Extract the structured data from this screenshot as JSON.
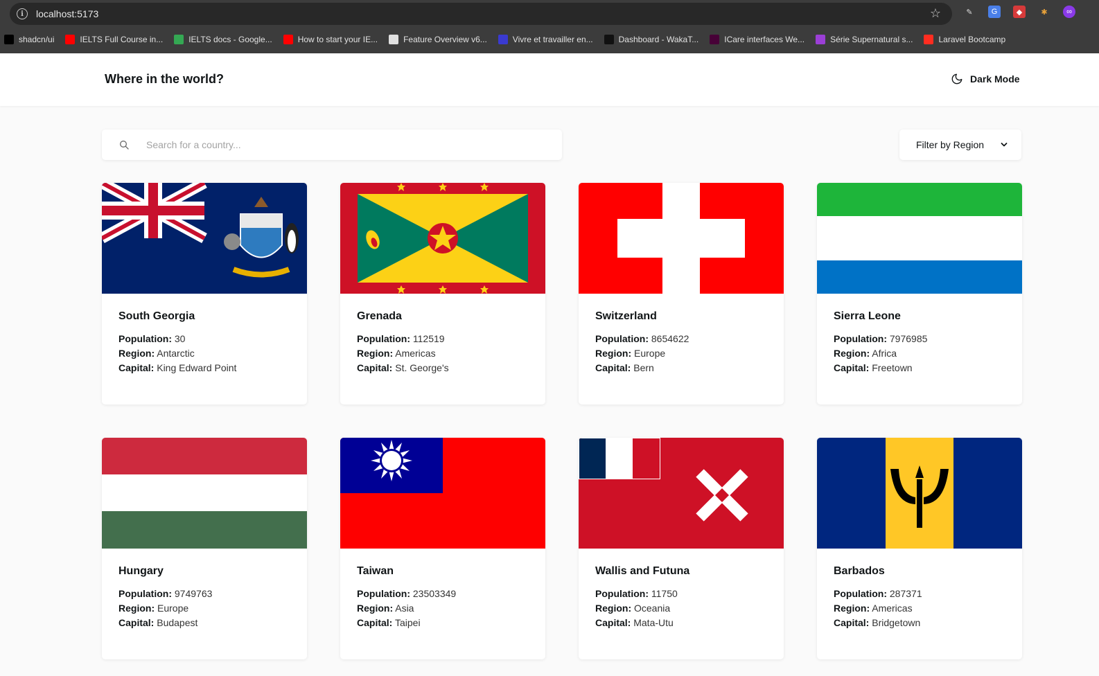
{
  "browser": {
    "url": "localhost:5173",
    "bookmarks": [
      {
        "label": "shadcn/ui",
        "icon": "shadcn-icon",
        "color": "#000000"
      },
      {
        "label": "IELTS Full Course in...",
        "icon": "youtube-icon",
        "color": "#ff0000"
      },
      {
        "label": "IELTS docs - Google...",
        "icon": "drive-icon",
        "color": "#34a853"
      },
      {
        "label": "How to start your IE...",
        "icon": "youtube-icon",
        "color": "#ff0000"
      },
      {
        "label": "Feature Overview v6...",
        "icon": "network-icon",
        "color": "#e0e0e0"
      },
      {
        "label": "Vivre et travailler en...",
        "icon": "quebec-icon",
        "color": "#3a3ad0"
      },
      {
        "label": "Dashboard - WakaT...",
        "icon": "wakatime-icon",
        "color": "#111111"
      },
      {
        "label": "ICare interfaces We...",
        "icon": "xd-icon",
        "color": "#470137"
      },
      {
        "label": "Série Supernatural s...",
        "icon": "flag-icon",
        "color": "#9b3fd6"
      },
      {
        "label": "Laravel Bootcamp",
        "icon": "laravel-icon",
        "color": "#ff2d20"
      }
    ]
  },
  "header": {
    "title": "Where in the world?",
    "dark_mode_label": "Dark Mode"
  },
  "search": {
    "placeholder": "Search for a country..."
  },
  "filter": {
    "label": "Filter by Region"
  },
  "labels": {
    "population": "Population:",
    "region": "Region:",
    "capital": "Capital:"
  },
  "countries": [
    {
      "name": "South Georgia",
      "population": "30",
      "region": "Antarctic",
      "capital": "King Edward Point",
      "flag": "south-georgia"
    },
    {
      "name": "Grenada",
      "population": "112519",
      "region": "Americas",
      "capital": "St. George's",
      "flag": "grenada"
    },
    {
      "name": "Switzerland",
      "population": "8654622",
      "region": "Europe",
      "capital": "Bern",
      "flag": "switzerland"
    },
    {
      "name": "Sierra Leone",
      "population": "7976985",
      "region": "Africa",
      "capital": "Freetown",
      "flag": "sierra-leone"
    },
    {
      "name": "Hungary",
      "population": "9749763",
      "region": "Europe",
      "capital": "Budapest",
      "flag": "hungary"
    },
    {
      "name": "Taiwan",
      "population": "23503349",
      "region": "Asia",
      "capital": "Taipei",
      "flag": "taiwan"
    },
    {
      "name": "Wallis and Futuna",
      "population": "11750",
      "region": "Oceania",
      "capital": "Mata-Utu",
      "flag": "wallis-futuna"
    },
    {
      "name": "Barbados",
      "population": "287371",
      "region": "Americas",
      "capital": "Bridgetown",
      "flag": "barbados"
    }
  ]
}
